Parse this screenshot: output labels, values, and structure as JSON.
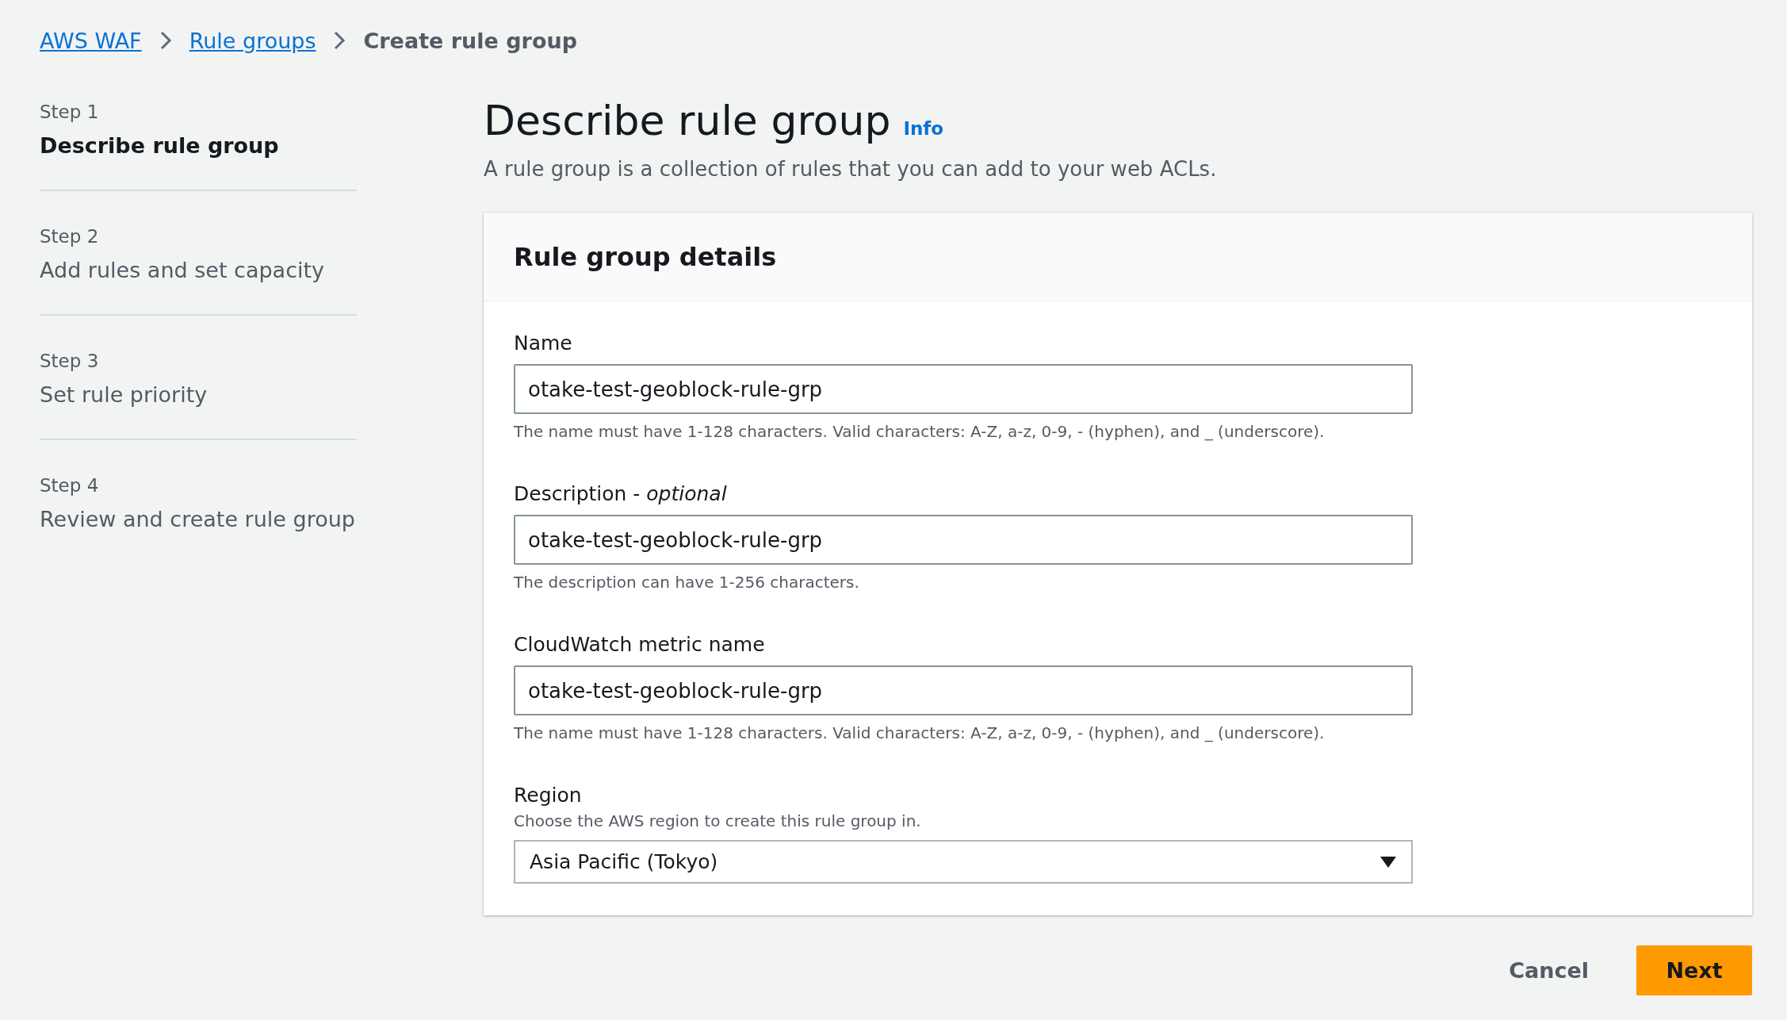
{
  "breadcrumb": [
    {
      "label": "AWS WAF",
      "link": true
    },
    {
      "label": "Rule groups",
      "link": true
    },
    {
      "label": "Create rule group",
      "link": false
    }
  ],
  "steps": [
    {
      "step": "Step 1",
      "title": "Describe rule group",
      "selected": true
    },
    {
      "step": "Step 2",
      "title": "Add rules and set capacity",
      "selected": false
    },
    {
      "step": "Step 3",
      "title": "Set rule priority",
      "selected": false
    },
    {
      "step": "Step 4",
      "title": "Review and create rule group",
      "selected": false
    }
  ],
  "page": {
    "title": "Describe rule group",
    "info": "Info",
    "description": "A rule group is a collection of rules that you can add to your web ACLs."
  },
  "card": {
    "title": "Rule group details",
    "fields": [
      {
        "kind": "input",
        "label": "Name",
        "value": "otake-test-geoblock-rule-grp",
        "hint": "The name must have 1-128 characters. Valid characters: A-Z, a-z, 0-9, - (hyphen), and _ (underscore)."
      },
      {
        "kind": "input",
        "label": "Description - *optional*",
        "value": "otake-test-geoblock-rule-grp",
        "hint": "The description can have 1-256 characters."
      },
      {
        "kind": "input",
        "label": "CloudWatch metric name",
        "value": "otake-test-geoblock-rule-grp",
        "hint": "The name must have 1-128 characters. Valid characters: A-Z, a-z, 0-9, - (hyphen), and _ (underscore)."
      },
      {
        "kind": "select",
        "label": "Region",
        "description": "Choose the AWS region to create this rule group in.",
        "value": "Asia Pacific (Tokyo)"
      }
    ]
  },
  "buttons": [
    {
      "label": "Cancel",
      "kind": "link"
    },
    {
      "label": "Next",
      "kind": "primary"
    }
  ]
}
